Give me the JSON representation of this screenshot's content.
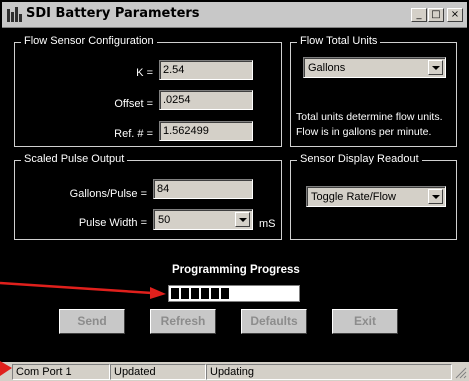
{
  "window": {
    "title": "SDI Battery Parameters",
    "controls": {
      "minimize": "_",
      "maximize": "□",
      "close": "×"
    }
  },
  "flow_sensor": {
    "title": "Flow Sensor Configuration",
    "k_label": "K =",
    "k_value": "2.54",
    "offset_label": "Offset =",
    "offset_value": ".0254",
    "ref_label": "Ref. # =",
    "ref_value": "1.562499"
  },
  "flow_units": {
    "title": "Flow Total Units",
    "selected": "Gallons",
    "info_line1": "Total units determine flow units.",
    "info_line2": "Flow is in gallons per minute."
  },
  "scaled_pulse": {
    "title": "Scaled Pulse Output",
    "gallons_label": "Gallons/Pulse =",
    "gallons_value": "84",
    "width_label": "Pulse Width =",
    "width_value": "50",
    "width_unit": "mS"
  },
  "sensor_display": {
    "title": "Sensor Display Readout",
    "selected": "Toggle Rate/Flow"
  },
  "progress": {
    "title": "Programming Progress",
    "segments_filled": 6,
    "fraction": 0.43
  },
  "buttons": {
    "send": "Send",
    "refresh": "Refresh",
    "defaults": "Defaults",
    "exit": "Exit"
  },
  "statusbar": {
    "port": "Com Port 1",
    "status1": "Updated",
    "status2": "Updating"
  },
  "colors": {
    "background": "#000000",
    "annotation_arrow": "#e0201c",
    "control_face": "#d4d0c8"
  }
}
